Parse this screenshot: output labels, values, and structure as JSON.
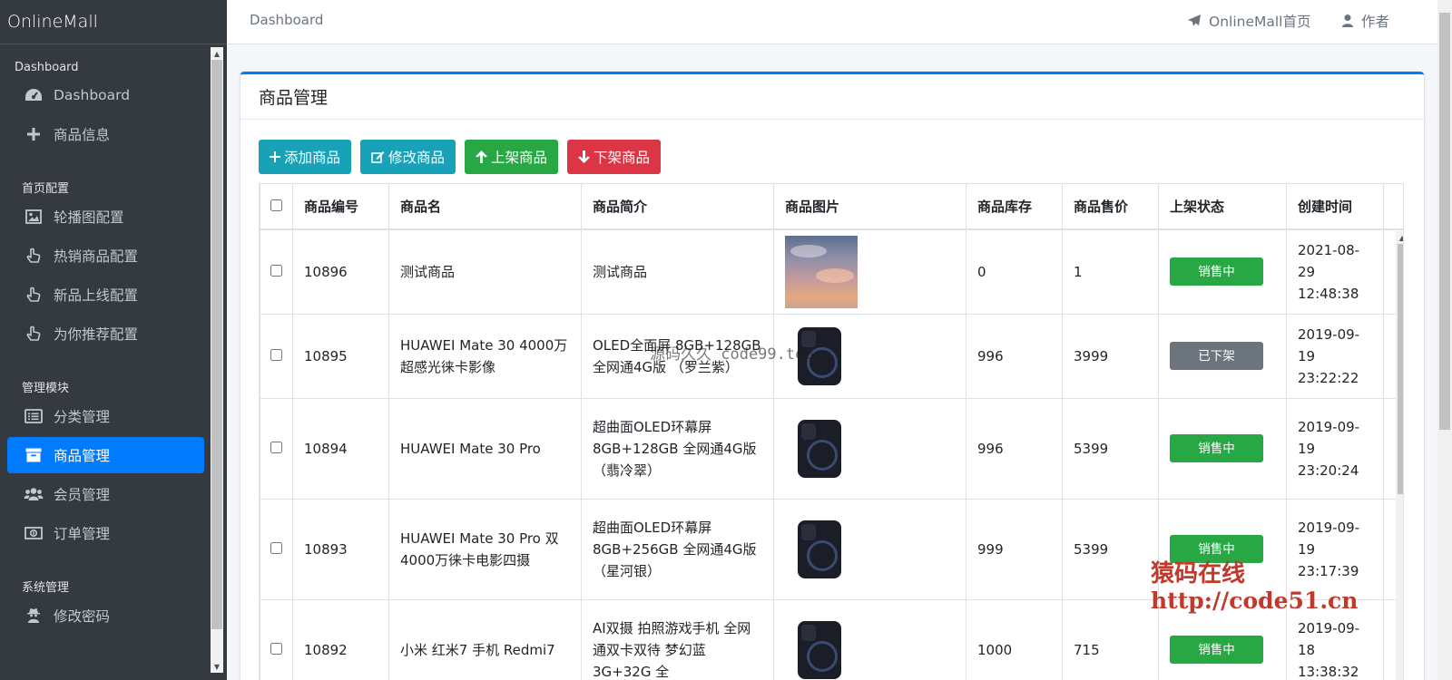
{
  "brand": "OnlineMall",
  "sidebar": {
    "sections": [
      {
        "header": "Dashboard",
        "items": [
          {
            "label": "Dashboard",
            "icon": "tachometer-icon"
          },
          {
            "label": "商品信息",
            "icon": "plus-icon"
          }
        ]
      },
      {
        "header": "首页配置",
        "items": [
          {
            "label": "轮播图配置",
            "icon": "image-icon"
          },
          {
            "label": "热销商品配置",
            "icon": "hand-pointer-icon"
          },
          {
            "label": "新品上线配置",
            "icon": "hand-pointer-icon"
          },
          {
            "label": "为你推荐配置",
            "icon": "hand-pointer-icon"
          }
        ]
      },
      {
        "header": "管理模块",
        "items": [
          {
            "label": "分类管理",
            "icon": "list-icon"
          },
          {
            "label": "商品管理",
            "icon": "archive-icon",
            "active": true
          },
          {
            "label": "会员管理",
            "icon": "users-icon"
          },
          {
            "label": "订单管理",
            "icon": "money-icon"
          }
        ]
      },
      {
        "header": "系统管理",
        "items": [
          {
            "label": "修改密码",
            "icon": "user-secret-icon"
          }
        ]
      }
    ]
  },
  "topbar": {
    "breadcrumb": "Dashboard",
    "home_link": "OnlineMall首页",
    "author_link": "作者"
  },
  "card": {
    "title": "商品管理",
    "buttons": {
      "add": "添加商品",
      "edit": "修改商品",
      "on_shelf": "上架商品",
      "off_shelf": "下架商品"
    }
  },
  "table": {
    "columns": [
      "商品编号",
      "商品名",
      "商品简介",
      "商品图片",
      "商品库存",
      "商品售价",
      "上架状态",
      "创建时间"
    ],
    "rows": [
      {
        "id": "10896",
        "name": "测试商品",
        "intro": "测试商品",
        "image": "sky",
        "stock": "0",
        "price": "1",
        "status": "销售中",
        "date": "2021-08-29",
        "time": "12:48:38"
      },
      {
        "id": "10895",
        "name": "HUAWEI Mate 30 4000万超感光徕卡影像",
        "intro": "OLED全面屏 8GB+128GB 全网通4G版 （罗兰紫）",
        "image": "phone",
        "stock": "996",
        "price": "3999",
        "status": "已下架",
        "date": "2019-09-19",
        "time": "23:22:22"
      },
      {
        "id": "10894",
        "name": "HUAWEI Mate 30 Pro",
        "intro": "超曲面OLED环幕屏 8GB+128GB 全网通4G版 （翡冷翠）",
        "image": "phone",
        "stock": "996",
        "price": "5399",
        "status": "销售中",
        "date": "2019-09-19",
        "time": "23:20:24"
      },
      {
        "id": "10893",
        "name": "HUAWEI Mate 30 Pro 双4000万徕卡电影四摄",
        "intro": "超曲面OLED环幕屏 8GB+256GB 全网通4G版 （星河银）",
        "image": "phone",
        "stock": "999",
        "price": "5399",
        "status": "销售中",
        "date": "2019-09-19",
        "time": "23:17:39"
      },
      {
        "id": "10892",
        "name": "小米 红米7 手机 Redmi7",
        "intro": "AI双摄 拍照游戏手机 全网通双卡双待 梦幻蓝 3G+32G 全",
        "image": "phone",
        "stock": "1000",
        "price": "715",
        "status": "销售中",
        "date": "2019-09-18",
        "time": "13:38:32"
      }
    ]
  },
  "watermarks": {
    "center": "源码久久 code99.top",
    "corner_title": "猿码在线",
    "corner_url": "http://code51.cn"
  },
  "colors": {
    "sidebar": "#343a40",
    "active": "#007bff",
    "info": "#17a2b8",
    "success": "#28a745",
    "danger": "#dc3545",
    "secondary": "#6c757d"
  }
}
